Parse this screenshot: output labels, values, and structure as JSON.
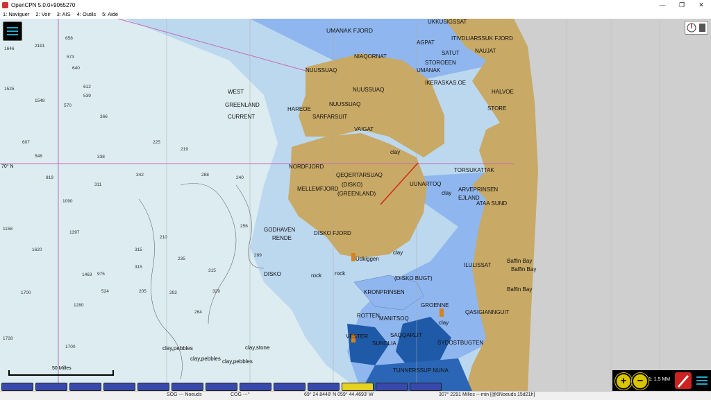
{
  "window": {
    "title": "OpenCPN 5.0.0+9065270",
    "buttons": [
      "—",
      "❐",
      "✕"
    ]
  },
  "menu": [
    "1: Naviguer",
    "2: Voir",
    "3: AIS",
    "4: Outils",
    "5: Aide"
  ],
  "chart": {
    "labels": {
      "umanak_fjord": "UMANAK FJORD",
      "ukkusigssat": "UKKUSIGSSAT",
      "agpat": "AGPAT",
      "itivdliarssuk_fjord": "ITIVDLIARSSUK FJORD",
      "satut": "SATUT",
      "naujat": "NAUJAT",
      "niaqornat": "NIAQORNAT",
      "storoeen": "STOROEEN",
      "umanak": "UMANAK",
      "ikeraskas_oe": "IKERASKAS.OE",
      "nuussuaq_1": "NUUSSUAQ",
      "nuussuaq_2": "NUUSSUAQ",
      "nuussuaq_3": "NUUSSUAQ",
      "halvoe": "HALVOE",
      "store": "STORE",
      "west": "WEST",
      "greenland": "GREENLAND",
      "current": "CURRENT",
      "hareoe": "HAREOE",
      "sarfarsuit": "SARFARSUIT",
      "vaigat": "VAIGAT",
      "clay_1": "clay",
      "nordfjord": "NORDFJORD",
      "qeqertarsuaq": "QEQERTARSUAQ",
      "disko_paren": "(DISKO)",
      "greenland_paren": "(GREENLAND)",
      "torsukattak": "TORSUKATTAK",
      "uunartoq": "UUNARTOQ",
      "arveprinsen": "ARVEPRINSEN",
      "ejland": "EJLAND",
      "ataa_sund": "ATAA SUND",
      "clay_2": "clay",
      "mellemfjord": "MELLEMFJORD",
      "godhaven": "GODHAVEN",
      "rende": "RENDE",
      "disko_fjord": "DISKO FJORD",
      "udkiggen": "Udkiggen",
      "clay_3": "clay",
      "ilulissat": "ILULISSAT",
      "baffin_bay_1": "Baffin Bay",
      "baffin_bay_2": "Baffin Bay",
      "baffin_bay_3": "Baffin Bay",
      "disko": "DISKO",
      "rock_1": "rock",
      "rock_2": "rock",
      "disko_bugt": "(DISKO BUGT)",
      "kronprinsen": "KRONPRINSEN",
      "groenne": "GROENNE",
      "qasigiannguit": "QASIGIANNGUIT",
      "rotten": "ROTTEN",
      "manitsoq": "MANITSOQ",
      "clay_4": "clay",
      "vester": "VESTER",
      "saqqarlit": "SAQQARLIT",
      "sundlia": "SUNDLIA",
      "sydostbugten": "SYDOSTBUGTEN",
      "clay_pebbles_1": "clay,pebbles",
      "clay_stone": "clay,stone",
      "clay_pebbles_2": "clay,pebbles",
      "clay_pebbles_3": "clay,pebbles",
      "tunnerssup_nuna": "TUNNERSSUP NUNA",
      "lat_70n": "70° N"
    },
    "depths_left": [
      "1646",
      "2191",
      "1525",
      "1548",
      "548",
      "607",
      "570",
      "819",
      "1090",
      "1158",
      "1397",
      "1620",
      "1463",
      "1700",
      "1280",
      "1728",
      "1700"
    ],
    "depths_mid": [
      "658",
      "573",
      "640",
      "612",
      "539",
      "366",
      "225",
      "219",
      "338",
      "311",
      "342",
      "288",
      "210",
      "315",
      "235",
      "315",
      "289",
      "329",
      "524",
      "975",
      "315",
      "205",
      "292",
      "264",
      "256",
      "240"
    ]
  },
  "overlay": {
    "scale_label": "50 Milles",
    "zoom_scale": "1: 1.5 MM",
    "chart_tab_labels": [
      "",
      "",
      "",
      "",
      "",
      "",
      "",
      "",
      "",
      "",
      "",
      "",
      "",
      "",
      "",
      "",
      "",
      "",
      ""
    ],
    "active_tab_label": ""
  },
  "status": {
    "sog": "SOG --- Noeuds",
    "cog": "COG ---°",
    "position": "69° 24.8448' N   059° 44.4693' W",
    "bearing_dist": "307°  2291 Milles ---min [@6Noeuds 15d21h]"
  },
  "colors": {
    "deep_water": "#dcecf0",
    "shallow_water": "#8fb6ee",
    "land": "#c8a965",
    "grid": "#c56ab6",
    "offchart": "#cfcfcf"
  },
  "icons": [
    "menu-icon",
    "compass-icon",
    "zoom-in-icon",
    "zoom-out-icon",
    "quilt-icon",
    "hamburger-icon",
    "light-icon"
  ]
}
